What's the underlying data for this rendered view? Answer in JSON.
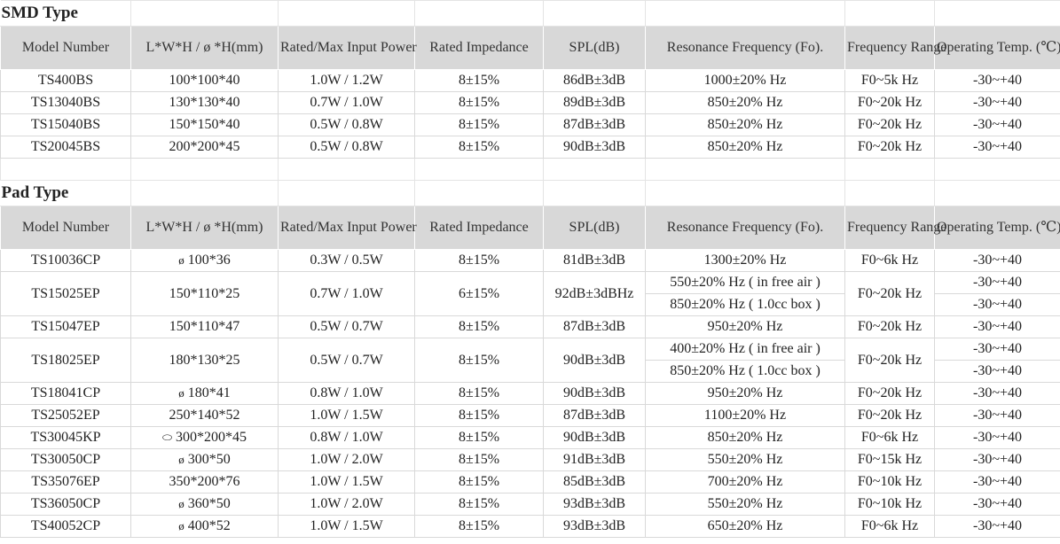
{
  "sections": [
    {
      "title": "SMD Type",
      "headers": [
        "Model Number",
        "L*W*H / ø *H(mm)",
        "Rated/Max Input Power",
        "Rated Impedance",
        "SPL(dB)",
        "Resonance Frequency (Fo).",
        "Frequency Range",
        "Operating Temp. (℃)"
      ],
      "rows": [
        [
          "TS400BS",
          "100*100*40",
          "1.0W / 1.2W",
          "8±15%",
          "86dB±3dB",
          "1000±20% Hz",
          "F0~5k Hz",
          "-30~+40"
        ],
        [
          "TS13040BS",
          "130*130*40",
          "0.7W / 1.0W",
          "8±15%",
          "89dB±3dB",
          "850±20% Hz",
          "F0~20k Hz",
          "-30~+40"
        ],
        [
          "TS15040BS",
          "150*150*40",
          "0.5W / 0.8W",
          "8±15%",
          "87dB±3dB",
          "850±20% Hz",
          "F0~20k Hz",
          "-30~+40"
        ],
        [
          "TS20045BS",
          "200*200*45",
          "0.5W / 0.8W",
          "8±15%",
          "90dB±3dB",
          "850±20% Hz",
          "F0~20k Hz",
          "-30~+40"
        ]
      ]
    },
    {
      "title": "Pad Type",
      "headers": [
        "Model Number",
        "L*W*H / ø *H(mm)",
        "Rated/Max Input Power",
        "Rated Impedance",
        "SPL(dB)",
        "Resonance Frequency (Fo).",
        "Frequency Range",
        "Operating Temp. (℃)"
      ],
      "rows": [
        {
          "model": "TS10036CP",
          "sym": "ø",
          "dim": "100*36",
          "power": "0.3W / 0.5W",
          "imp": "8±15%",
          "spl": "81dB±3dB",
          "fo": [
            "1300±20% Hz"
          ],
          "range": "F0~6k Hz",
          "temp": [
            "-30~+40"
          ]
        },
        {
          "model": "TS15025EP",
          "sym": "",
          "dim": "150*110*25",
          "power": "0.7W / 1.0W",
          "imp": "6±15%",
          "spl": "92dB±3dBHz",
          "fo": [
            "550±20% Hz ( in free air )",
            "850±20% Hz ( 1.0cc box )"
          ],
          "range": "F0~20k Hz",
          "temp": [
            "-30~+40",
            "-30~+40"
          ]
        },
        {
          "model": "TS15047EP",
          "sym": "",
          "dim": "150*110*47",
          "power": "0.5W / 0.7W",
          "imp": "8±15%",
          "spl": "87dB±3dB",
          "fo": [
            "950±20% Hz"
          ],
          "range": "F0~20k Hz",
          "temp": [
            "-30~+40"
          ]
        },
        {
          "model": "TS18025EP",
          "sym": "",
          "dim": "180*130*25",
          "power": "0.5W / 0.7W",
          "imp": "8±15%",
          "spl": "90dB±3dB",
          "fo": [
            "400±20% Hz ( in free air )",
            "850±20% Hz ( 1.0cc box )"
          ],
          "range": "F0~20k Hz",
          "temp": [
            "-30~+40",
            "-30~+40"
          ]
        },
        {
          "model": "TS18041CP",
          "sym": "ø",
          "dim": "180*41",
          "power": "0.8W / 1.0W",
          "imp": "8±15%",
          "spl": "90dB±3dB",
          "fo": [
            "950±20% Hz"
          ],
          "range": "F0~20k Hz",
          "temp": [
            "-30~+40"
          ]
        },
        {
          "model": "TS25052EP",
          "sym": "",
          "dim": "250*140*52",
          "power": "1.0W / 1.5W",
          "imp": "8±15%",
          "spl": "87dB±3dB",
          "fo": [
            "1100±20% Hz"
          ],
          "range": "F0~20k Hz",
          "temp": [
            "-30~+40"
          ]
        },
        {
          "model": "TS30045KP",
          "sym": "⬭",
          "dim": "300*200*45",
          "power": "0.8W / 1.0W",
          "imp": "8±15%",
          "spl": "90dB±3dB",
          "fo": [
            "850±20% Hz"
          ],
          "range": "F0~6k Hz",
          "temp": [
            "-30~+40"
          ]
        },
        {
          "model": "TS30050CP",
          "sym": "ø",
          "dim": "300*50",
          "power": "1.0W / 2.0W",
          "imp": "8±15%",
          "spl": "91dB±3dB",
          "fo": [
            "550±20% Hz"
          ],
          "range": "F0~15k Hz",
          "temp": [
            "-30~+40"
          ]
        },
        {
          "model": "TS35076EP",
          "sym": "",
          "dim": "350*200*76",
          "power": "1.0W / 1.5W",
          "imp": "8±15%",
          "spl": "85dB±3dB",
          "fo": [
            "700±20% Hz"
          ],
          "range": "F0~10k Hz",
          "temp": [
            "-30~+40"
          ]
        },
        {
          "model": "TS36050CP",
          "sym": "ø",
          "dim": "360*50",
          "power": "1.0W / 2.0W",
          "imp": "8±15%",
          "spl": "93dB±3dB",
          "fo": [
            "550±20% Hz"
          ],
          "range": "F0~10k Hz",
          "temp": [
            "-30~+40"
          ]
        },
        {
          "model": "TS40052CP",
          "sym": "ø",
          "dim": "400*52",
          "power": "1.0W / 1.5W",
          "imp": "8±15%",
          "spl": "93dB±3dB",
          "fo": [
            "650±20% Hz"
          ],
          "range": "F0~6k Hz",
          "temp": [
            "-30~+40"
          ]
        }
      ]
    }
  ],
  "colors": {
    "header_bg": "#d8d8d8",
    "grid": "#d9d9d9",
    "text": "#222222"
  }
}
